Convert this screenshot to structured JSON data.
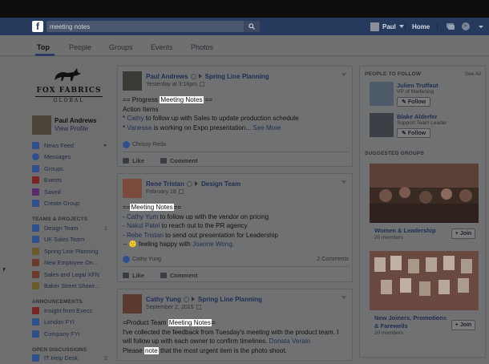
{
  "nav": {
    "logo": "f",
    "search_value": "meeting notes",
    "user": "Paul",
    "home": "Home"
  },
  "tabs": [
    "Top",
    "People",
    "Groups",
    "Events",
    "Photos"
  ],
  "left": {
    "brand_name": "FOX FABRICS",
    "brand_sub": "GLOBAL",
    "profile_name": "Paul Andrews",
    "profile_link": "View Profile",
    "menu": [
      {
        "label": "News Feed",
        "icon": "news-feed-icon",
        "color": "#2f4f8c"
      },
      {
        "label": "Messages",
        "icon": "messages-icon",
        "color": "#2f4f8c"
      },
      {
        "label": "Groups",
        "icon": "groups-icon",
        "color": "#2f4f8c"
      },
      {
        "label": "Events",
        "icon": "events-icon",
        "color": "#7a2424"
      },
      {
        "label": "Saved",
        "icon": "saved-icon",
        "color": "#5a2a6e"
      },
      {
        "label": "Create Group",
        "icon": "create-group-icon",
        "color": "#2f4f8c"
      }
    ],
    "teams_header": "TEAMS & PROJECTS",
    "teams": [
      {
        "label": "Design Team",
        "count": "1",
        "icon": "team-icon",
        "color": "#2f4f8c"
      },
      {
        "label": "UK Sales Team",
        "count": "",
        "icon": "team-icon",
        "color": "#2f4f8c"
      },
      {
        "label": "Spring Line Planning",
        "count": "",
        "icon": "project-icon",
        "color": "#6b5a2a"
      },
      {
        "label": "New Employee On...",
        "count": "",
        "icon": "project-icon",
        "color": "#6b3a2a"
      },
      {
        "label": "Sales and Legal XFN",
        "count": "",
        "icon": "project-icon",
        "color": "#6b3a2a"
      },
      {
        "label": "Baker Street Showr...",
        "count": "",
        "icon": "project-icon",
        "color": "#6b5a2a"
      }
    ],
    "announcements_header": "ANNOUNCEMENTS",
    "announcements": [
      {
        "label": "Insight from Execs",
        "icon": "announcement-icon",
        "color": "#7a2424"
      },
      {
        "label": "London FYI",
        "icon": "announcement-icon",
        "color": "#2f4f8c"
      },
      {
        "label": "Company FYI",
        "icon": "announcement-icon",
        "color": "#2f4f8c"
      }
    ],
    "discussions_header": "OPEN DISCUSSIONS",
    "discussions": [
      {
        "label": "IT Help Desk",
        "count": "2",
        "icon": "discussion-icon",
        "color": "#2f4f8c"
      }
    ]
  },
  "posts": [
    {
      "author": "Paul Andrews",
      "group": "Spring Line Planning",
      "time": "Yesterday at 3:16pm",
      "lines": [
        {
          "pre": "== Progress ",
          "hl": "Meeting Notes",
          "post": " =="
        },
        {
          "pre": "Action Items",
          "hl": "",
          "post": ""
        },
        {
          "pre": "* ",
          "link": "Cathy",
          "post": " to follow up with Sales to update production schedule"
        },
        {
          "pre": "* ",
          "link": "Vanessa",
          "post": " is working on Expo presentation... ",
          "more": "See More"
        }
      ],
      "reactor": "Chrissy Reda",
      "comments": "",
      "like": "Like",
      "comment": "Comment"
    },
    {
      "author": "Rene Tristan",
      "group": "Design Team",
      "time": "February 18",
      "lines": [
        {
          "pre": "==",
          "hl": "Meeting Notes",
          "post": "=="
        },
        {
          "pre": "- ",
          "link": "Cathy Yum",
          "post": " to follow up with the vendor on pricing"
        },
        {
          "pre": "- ",
          "link": "Nakul Patel",
          "post": " to reach out to the PR agency"
        },
        {
          "pre": "- ",
          "link": "Rebe Tristan",
          "post": " to send out presentation for Leadership"
        },
        {
          "pre": "-- 🙂 feeling happy with ",
          "link": "Joanne Wong",
          "post": "."
        }
      ],
      "reactor": "Cathy Yung",
      "comments": "2 Comments",
      "like": "Like",
      "comment": "Comment"
    },
    {
      "author": "Cathy Yung",
      "group": "Spring Line Planning",
      "time": "September 2, 2015",
      "lines": [
        {
          "pre": "=Product Team ",
          "hl": "Meeting Notes",
          "post": "="
        },
        {
          "pre": "I've collected the feedback from Tuesday's meeting with the product team. I",
          "hl": "",
          "post": ""
        },
        {
          "pre": "will follow up with each owner to confirm timelines. ",
          "link": "Donata Verain",
          "post": ""
        },
        {
          "pre": "Please ",
          "hl": "note",
          "post": " that the most urgent item is the photo shoot."
        }
      ]
    }
  ],
  "right": {
    "people_header": "PEOPLE TO FOLLOW",
    "see_all": "See All",
    "people": [
      {
        "name": "Julien Truffaut",
        "title": "VP of Marketing",
        "button": "Follow"
      },
      {
        "name": "Blake Alderfer",
        "title": "Support Team Leader",
        "button": "Follow"
      }
    ],
    "groups_header": "SUGGESTED GROUPS",
    "groups": [
      {
        "name": "Women & Leadership",
        "members": "20 members",
        "button": "+ Join"
      },
      {
        "name": "New Joiners, Promotions & Farewells",
        "name_l1": "New Joiners, Promotions",
        "name_l2": "& Farewells",
        "members": "20 members",
        "button": "+ Join"
      }
    ]
  }
}
